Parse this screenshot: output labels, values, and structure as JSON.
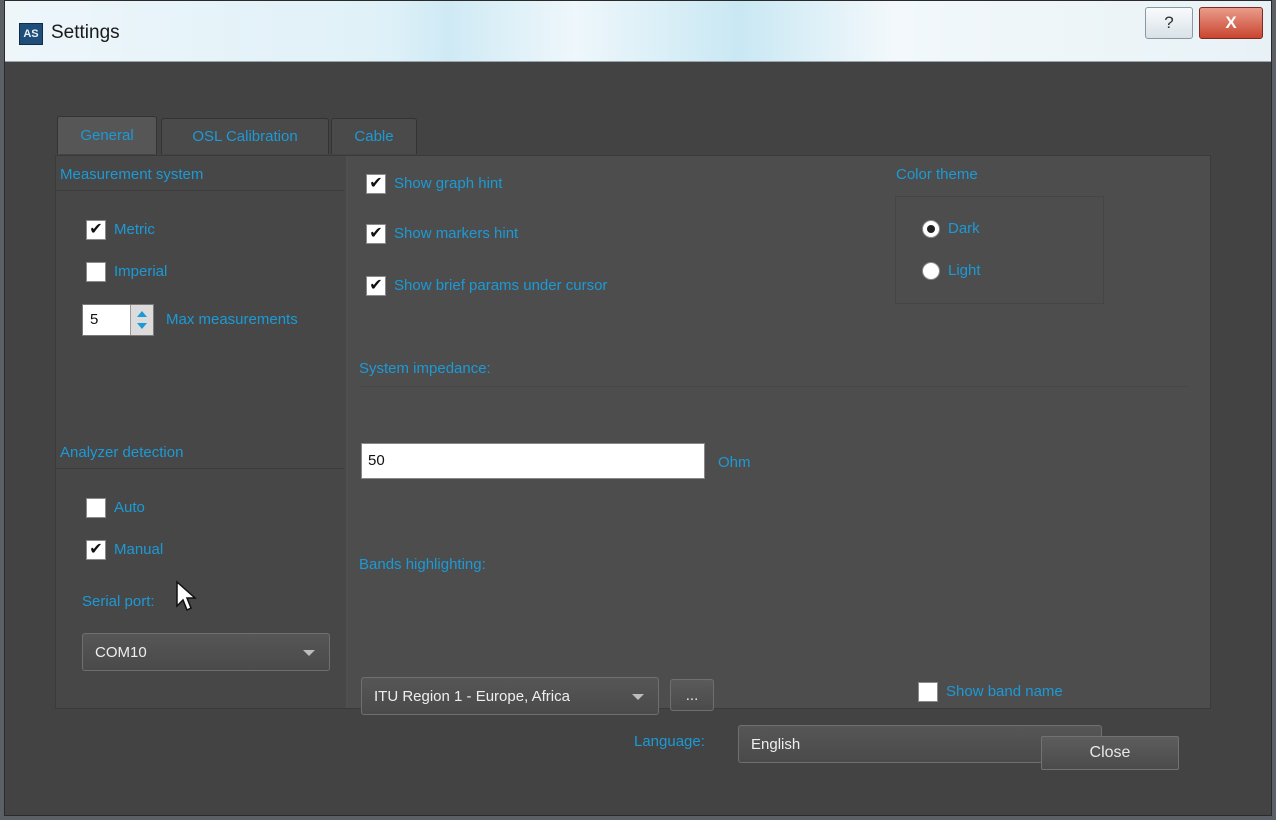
{
  "window": {
    "app_icon_text": "AS",
    "title": "Settings",
    "help_button": "?",
    "close_button": "X"
  },
  "tabs": [
    {
      "label": "General",
      "active": true
    },
    {
      "label": "OSL Calibration",
      "active": false
    },
    {
      "label": "Cable",
      "active": false
    }
  ],
  "measurement_system": {
    "heading": "Measurement system",
    "options": [
      {
        "label": "Metric",
        "checked": true
      },
      {
        "label": "Imperial",
        "checked": false
      }
    ],
    "max_measurements": {
      "value": "5",
      "label": "Max measurements"
    }
  },
  "hints": [
    {
      "label": "Show graph hint",
      "checked": true
    },
    {
      "label": "Show markers hint",
      "checked": true
    },
    {
      "label": "Show brief params under cursor",
      "checked": true
    }
  ],
  "color_theme": {
    "heading": "Color theme",
    "options": [
      {
        "label": "Dark",
        "selected": true
      },
      {
        "label": "Light",
        "selected": false
      }
    ]
  },
  "system_impedance": {
    "heading": "System impedance:",
    "value": "50",
    "unit": "Ohm"
  },
  "analyzer_detection": {
    "heading": "Analyzer detection",
    "options": [
      {
        "label": "Auto",
        "checked": false
      },
      {
        "label": "Manual",
        "checked": true
      }
    ],
    "serial_port_label": "Serial port:",
    "serial_port_value": "COM10"
  },
  "bands": {
    "heading": "Bands highlighting:",
    "region_value": "ITU Region 1 - Europe, Africa",
    "more_button": "...",
    "show_band_name": {
      "label": "Show band name",
      "checked": false
    }
  },
  "language": {
    "label": "Language:",
    "value": "English"
  },
  "footer": {
    "close_label": "Close"
  },
  "colors": {
    "accent": "#1c9ad6",
    "background": "#434343",
    "panel": "#4f4f4f"
  }
}
